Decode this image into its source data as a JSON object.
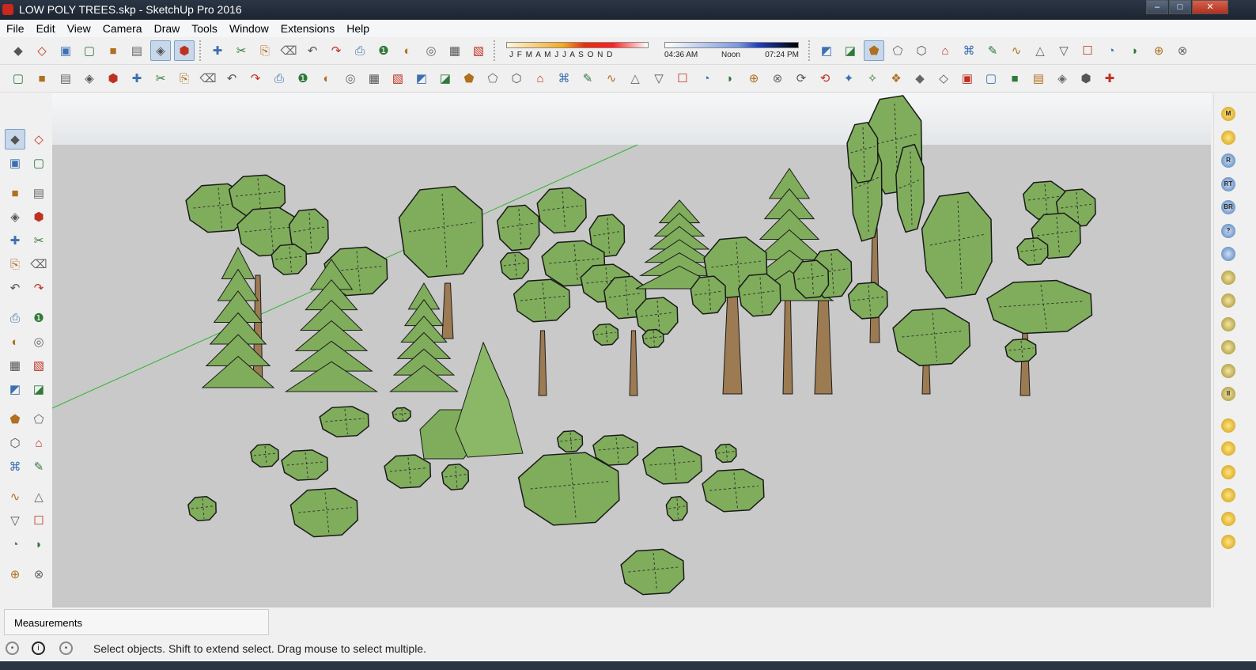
{
  "window": {
    "title": "LOW POLY TREES.skp - SketchUp Pro 2016",
    "minimize": "–",
    "maximize": "□",
    "close": "✕"
  },
  "menu": [
    "File",
    "Edit",
    "View",
    "Camera",
    "Draw",
    "Tools",
    "Window",
    "Extensions",
    "Help"
  ],
  "toolbar1": {
    "icons_a": [
      "iso-view-icon",
      "top-view-icon",
      "front-view-icon",
      "right-view-icon",
      "back-view-icon",
      "xray-icon",
      "shaded-textures-icon",
      "monochrome-icon"
    ],
    "icons_b": [
      "add-3d-warehouse-icon",
      "open-icon",
      "save-icon",
      "cut-icon",
      "copy-icon",
      "paste-icon",
      "erase-icon",
      "undo-icon",
      "redo-icon",
      "print-icon",
      "model-info-icon",
      "shadows-toggle-icon"
    ],
    "shadow": {
      "months": "J F M A M J J A S O N D",
      "sunrise": "04:36 AM",
      "noon": "Noon",
      "sunset": "07:24 PM"
    },
    "icons_c": [
      "position-camera-icon",
      "section-plane-icon",
      "display-section-icon",
      "sandbox-from-contours-icon",
      "sandbox-from-scratch-icon",
      "smoove-icon",
      "stamp-icon",
      "drape-icon",
      "add-detail-icon",
      "flip-edge-icon",
      "layers-icon",
      "outliner-icon",
      "components-icon",
      "materials-icon",
      "styles-icon",
      "scenes-icon"
    ]
  },
  "toolbar2": {
    "icons": [
      "warehouse-icon",
      "components-icon",
      "house-icon",
      "house2-icon",
      "house3-icon",
      "house4-icon",
      "plugin-red-icon",
      "plugin-leaf-icon",
      "plugin-gray-icon",
      "plugin-orange-icon",
      "bezier-icon",
      "curve-icon",
      "spiral-icon",
      "cut-icon",
      "polyline-icon",
      "shape-icon",
      "hook-icon",
      "cube-icon",
      "sphere-icon",
      "arc-icon",
      "corner-icon",
      "fillet-icon",
      "knife-icon",
      "bend-icon",
      "arch-icon",
      "protractor-icon",
      "stairs-icon",
      "spring-icon",
      "hand-icon",
      "panel-icon",
      "wedge-icon",
      "lines-icon",
      "ramp-icon",
      "arrows-icon",
      "fan-icon",
      "split-icon",
      "box-icon",
      "stack-icon",
      "slice-icon",
      "step-icon",
      "grid-icon",
      "hatch-icon",
      "layers-icon",
      "twist-icon",
      "wave-icon",
      "spiral2-icon",
      "loft-icon"
    ]
  },
  "left_tools": [
    "select-icon",
    "make-component-icon",
    "paint-bucket-icon",
    "eraser-icon",
    "line-icon",
    "freehand-icon",
    "rectangle-icon",
    "rotated-rectangle-icon",
    "circle-icon",
    "polygon-icon",
    "arc-icon",
    "two-point-arc-icon",
    "three-point-arc-icon",
    "pie-icon",
    "move-icon",
    "push-pull-icon",
    "rotate-icon",
    "follow-me-icon",
    "scale-icon",
    "offset-icon",
    "tape-measure-icon",
    "dimension-icon",
    "protractor-icon",
    "text-icon",
    "axes-icon",
    "3d-text-icon",
    "orbit-icon",
    "pan-icon",
    "zoom-icon",
    "zoom-window-icon",
    "zoom-extents-icon",
    "previous-view-icon",
    "position-camera-icon",
    "look-around-icon",
    "walk-icon",
    "section-plane-icon"
  ],
  "right_tools": [
    {
      "icon": "m-icon",
      "label": "M"
    },
    {
      "icon": "tag-icon",
      "label": ""
    },
    {
      "icon": "r-icon",
      "label": "R"
    },
    {
      "icon": "rt-icon",
      "label": "RT"
    },
    {
      "icon": "br-icon",
      "label": "BR"
    },
    {
      "icon": "help-icon",
      "label": "?"
    },
    {
      "icon": "tag2-icon",
      "label": ""
    },
    {
      "icon": "sun-icon",
      "label": ""
    },
    {
      "icon": "lines-icon",
      "label": ""
    },
    {
      "icon": "terrain-icon",
      "label": ""
    },
    {
      "icon": "terrain2-icon",
      "label": ""
    },
    {
      "icon": "target-icon",
      "label": ""
    },
    {
      "icon": "pause-icon",
      "label": "II"
    },
    {
      "icon": "ball-icon",
      "label": ""
    },
    {
      "icon": "light-icon",
      "label": ""
    },
    {
      "icon": "spot-icon",
      "label": ""
    },
    {
      "icon": "dome-icon",
      "label": ""
    },
    {
      "icon": "orb-icon",
      "label": ""
    },
    {
      "icon": "flag-icon",
      "label": ""
    }
  ],
  "measurements": {
    "label": "Measurements"
  },
  "status": {
    "message": "Select objects. Shift to extend select. Drag mouse to select multiple."
  },
  "colors": {
    "foliage": "#80ad5c",
    "trunk": "#9c7a52",
    "ground": "#c9c9c9",
    "axis_green": "#2fb52f"
  }
}
